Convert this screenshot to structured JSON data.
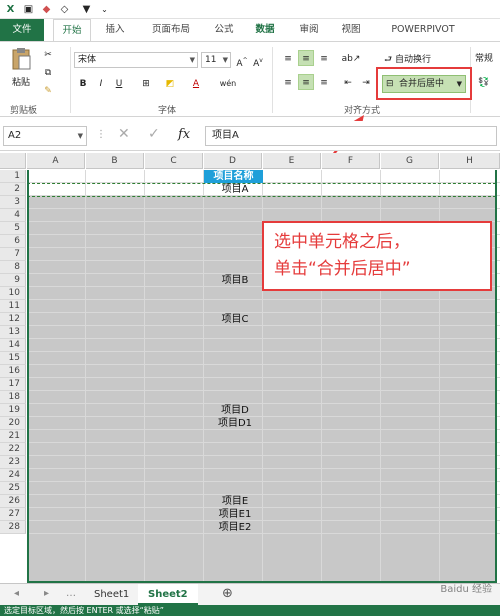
{
  "quick_access": [
    "excel-icon",
    "save-icon",
    "undo-icon",
    "redo-icon",
    "filter-icon",
    "customize-icon"
  ],
  "tabs": [
    "文件",
    "开始",
    "插入",
    "页面布局",
    "公式",
    "数据",
    "审阅",
    "视图",
    "POWERPIVOT"
  ],
  "ribbon": {
    "clipboard": {
      "paste_label": "粘贴",
      "group_label": "剪贴板"
    },
    "font": {
      "font_name": "宋体",
      "font_size": "11",
      "bold": "B",
      "italic": "I",
      "underline": "U",
      "group_label": "字体"
    },
    "alignment": {
      "wrap_label": "自动换行",
      "merge_label": "合并后居中",
      "group_label": "对齐方式"
    },
    "number": {
      "format": "常规"
    }
  },
  "formula_bar": {
    "name_box": "A2",
    "fx": "fx",
    "value": "项目A"
  },
  "columns": [
    "A",
    "B",
    "C",
    "D",
    "E",
    "F",
    "G",
    "H"
  ],
  "rows": [
    "1",
    "2",
    "3",
    "4",
    "5",
    "6",
    "7",
    "8",
    "9",
    "10",
    "11",
    "12",
    "13",
    "14",
    "15",
    "16",
    "17",
    "18",
    "19",
    "20",
    "21",
    "22",
    "23",
    "24",
    "25",
    "26",
    "27",
    "28"
  ],
  "cells": {
    "header": "项目名称",
    "r2": "项目A",
    "r9": "项目B",
    "r12": "项目C",
    "r17": "项目D",
    "r18": "项目D1",
    "r23": "项目E",
    "r24": "项目E1",
    "r25": "项目E2"
  },
  "annotation": {
    "line1": "选中单元格之后，",
    "line2": "单击“合并后居中”"
  },
  "sheets": [
    "Sheet1",
    "Sheet2"
  ],
  "status": "选定目标区域，然后按 ENTER 或选择“粘贴”",
  "watermark": "Baidu 经验",
  "colors": {
    "accent": "#217346",
    "header_fill": "#1e9fd9",
    "annotation": "#e53b3b"
  }
}
